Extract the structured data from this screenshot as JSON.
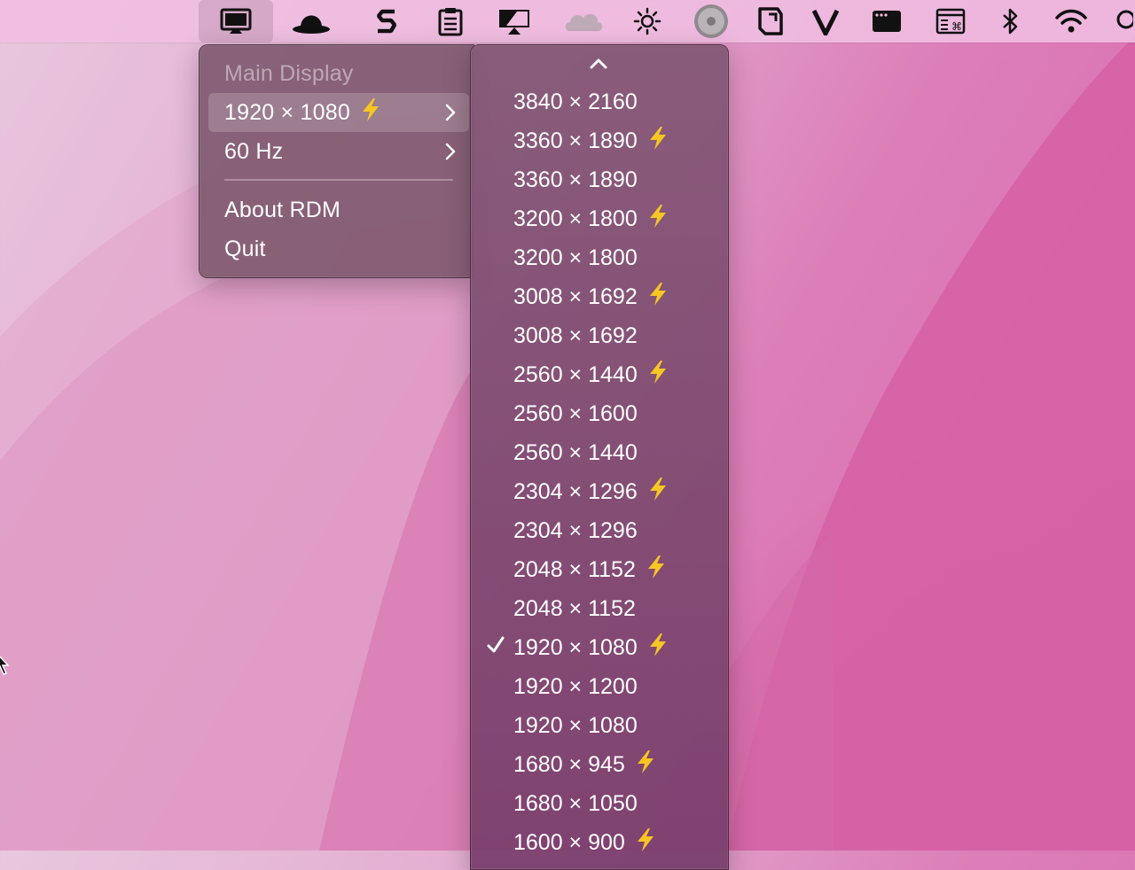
{
  "menubar": {
    "items": [
      {
        "name": "rdm-display-icon"
      },
      {
        "name": "bowler-hat-icon"
      },
      {
        "name": "s-logo-icon"
      },
      {
        "name": "clipboard-icon"
      },
      {
        "name": "airplay-display-icon"
      },
      {
        "name": "cloud-icon"
      },
      {
        "name": "brightness-icon"
      },
      {
        "name": "disk-icon"
      },
      {
        "name": "tag-icon"
      },
      {
        "name": "v-logo-icon"
      },
      {
        "name": "window-icon"
      },
      {
        "name": "shortcut-window-icon"
      },
      {
        "name": "bluetooth-icon"
      },
      {
        "name": "wifi-icon"
      },
      {
        "name": "search-icon"
      }
    ]
  },
  "main_menu": {
    "header": "Main Display",
    "resolution_item": "1920 × 1080",
    "refresh_item": "60 Hz",
    "about": "About RDM",
    "quit": "Quit"
  },
  "resolutions": [
    {
      "label": "3840 × 2160",
      "hidpi": false,
      "checked": false
    },
    {
      "label": "3360 × 1890",
      "hidpi": true,
      "checked": false
    },
    {
      "label": "3360 × 1890",
      "hidpi": false,
      "checked": false
    },
    {
      "label": "3200 × 1800",
      "hidpi": true,
      "checked": false
    },
    {
      "label": "3200 × 1800",
      "hidpi": false,
      "checked": false
    },
    {
      "label": "3008 × 1692",
      "hidpi": true,
      "checked": false
    },
    {
      "label": "3008 × 1692",
      "hidpi": false,
      "checked": false
    },
    {
      "label": "2560 × 1440",
      "hidpi": true,
      "checked": false
    },
    {
      "label": "2560 × 1600",
      "hidpi": false,
      "checked": false
    },
    {
      "label": "2560 × 1440",
      "hidpi": false,
      "checked": false
    },
    {
      "label": "2304 × 1296",
      "hidpi": true,
      "checked": false
    },
    {
      "label": "2304 × 1296",
      "hidpi": false,
      "checked": false
    },
    {
      "label": "2048 × 1152",
      "hidpi": true,
      "checked": false
    },
    {
      "label": "2048 × 1152",
      "hidpi": false,
      "checked": false
    },
    {
      "label": "1920 × 1080",
      "hidpi": true,
      "checked": true
    },
    {
      "label": "1920 × 1200",
      "hidpi": false,
      "checked": false
    },
    {
      "label": "1920 × 1080",
      "hidpi": false,
      "checked": false
    },
    {
      "label": "1680 × 945",
      "hidpi": true,
      "checked": false
    },
    {
      "label": "1680 × 1050",
      "hidpi": false,
      "checked": false
    },
    {
      "label": "1600 × 900",
      "hidpi": true,
      "checked": false
    }
  ],
  "colors": {
    "bolt": "#f7c623",
    "menu_bg": "#805a70"
  }
}
